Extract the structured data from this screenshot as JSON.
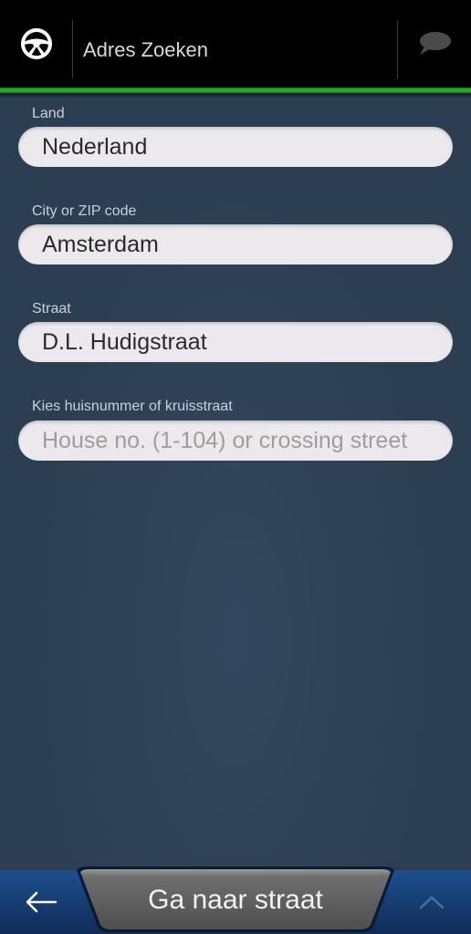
{
  "header": {
    "title": "Adres Zoeken",
    "left_icon": "steering-wheel-icon",
    "right_icon": "chat-bubble-icon"
  },
  "fields": [
    {
      "label": "Land",
      "value": "Nederland",
      "placeholder": ""
    },
    {
      "label": "City or ZIP code",
      "value": "Amsterdam",
      "placeholder": ""
    },
    {
      "label": "Straat",
      "value": "D.L. Hudigstraat",
      "placeholder": ""
    },
    {
      "label": "Kies huisnummer of kruisstraat",
      "value": "",
      "placeholder": "House no. (1-104) or crossing street"
    }
  ],
  "bottom_bar": {
    "back_icon": "arrow-left-icon",
    "primary_label": "Ga naar straat",
    "up_icon": "chevron-up-icon"
  },
  "colors": {
    "accent_green": "#36b336",
    "background": "#2c3e52",
    "bottom_bar_blue": "#1d4f8e"
  }
}
